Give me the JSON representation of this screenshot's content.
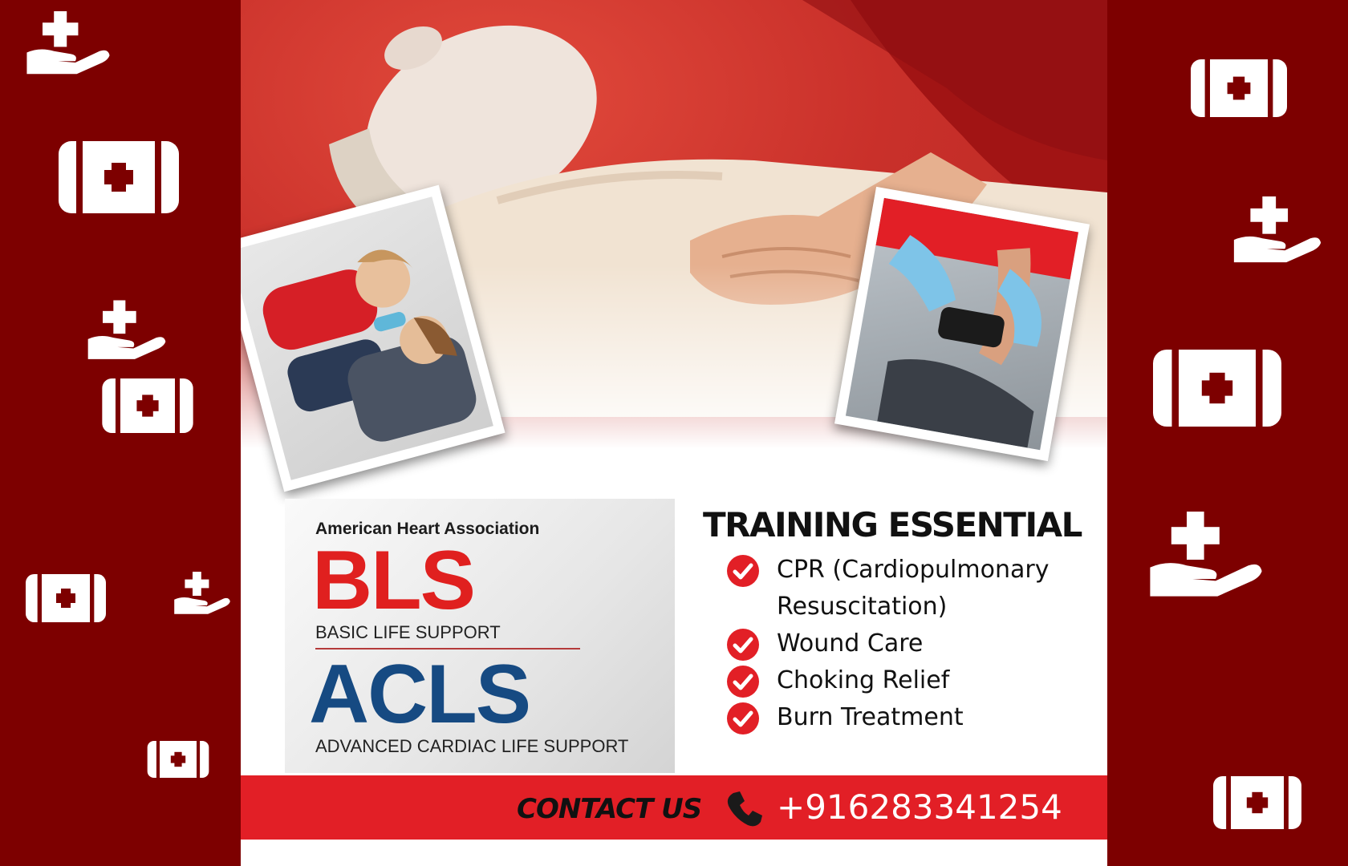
{
  "colors": {
    "maroon": "#7d0000",
    "red": "#e21f26",
    "navy": "#164a82",
    "white": "#ffffff"
  },
  "icons": {
    "hand_plus": "hand-with-plus-icon",
    "kit": "first-aid-kit-icon"
  },
  "banner": {
    "association": "American Heart Association",
    "bls": "BLS",
    "bls_subtitle": "BASIC LIFE SUPPORT",
    "acls": "ACLS",
    "acls_subtitle": "ADVANCED CARDIAC LIFE SUPPORT"
  },
  "training": {
    "title": "TRAINING ESSENTIAL",
    "items": [
      "CPR (Cardiopulmonary Resuscitation)",
      "Wound Care",
      "Choking Relief",
      "Burn Treatment"
    ]
  },
  "contact": {
    "label": "CONTACT US",
    "phone": "+916283341254"
  }
}
